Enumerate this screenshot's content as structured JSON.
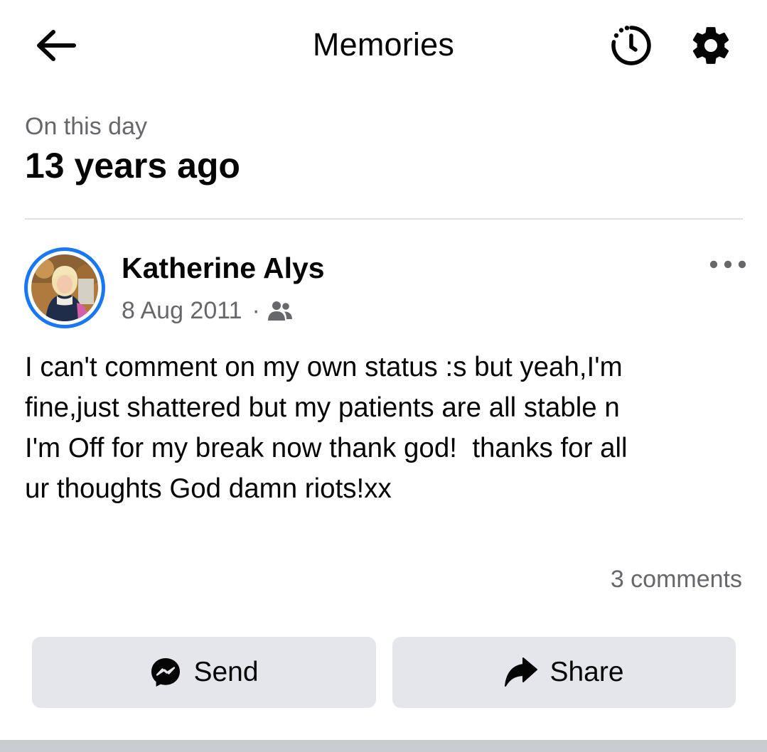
{
  "header": {
    "title": "Memories",
    "back_icon": "back-arrow-icon",
    "timer_icon": "timer-icon",
    "settings_icon": "gear-icon"
  },
  "memory": {
    "label": "On this day",
    "years_ago": "13 years ago"
  },
  "post": {
    "author": "Katherine Alys",
    "date": "8 Aug 2011",
    "separator": "·",
    "audience_icon": "friends-icon",
    "more_icon": "more-options-icon",
    "text": "I can't comment on my own status :s but yeah,I'm\nfine,just shattered but my patients are all stable n\nI'm Off for my break now thank god!  thanks for all\nur thoughts God damn riots!xx",
    "comments": "3 comments"
  },
  "actions": {
    "send_label": "Send",
    "send_icon": "messenger-icon",
    "share_label": "Share",
    "share_icon": "share-arrow-icon"
  },
  "colors": {
    "accent": "#1877f2",
    "secondary_text": "#65676b",
    "button_bg": "#e4e6eb",
    "divider": "#dcdfe3"
  }
}
